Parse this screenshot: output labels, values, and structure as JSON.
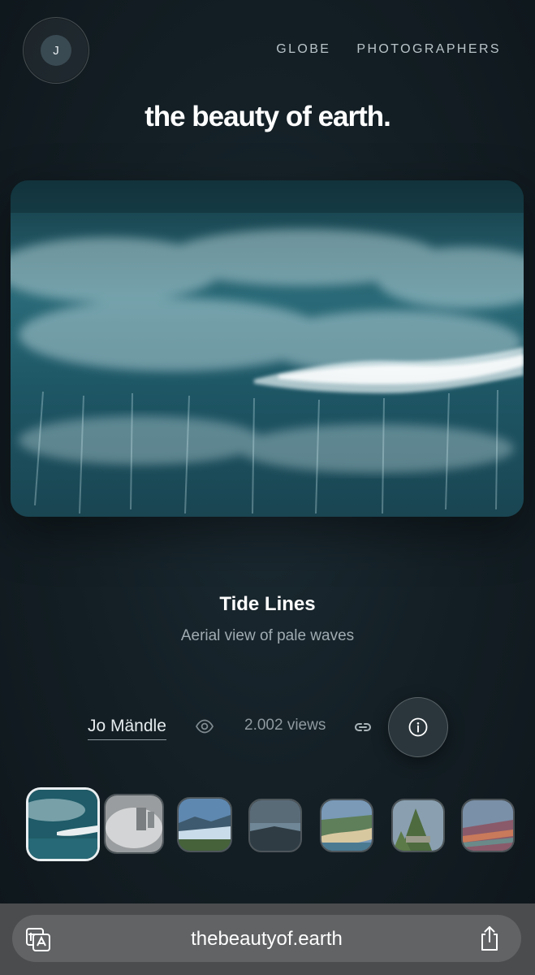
{
  "header": {
    "avatar_initial": "J",
    "nav": [
      {
        "label": "GLOBE"
      },
      {
        "label": "PHOTOGRAPHERS"
      }
    ]
  },
  "site_title": "the beauty of earth.",
  "photo": {
    "title": "Tide Lines",
    "description": "Aerial view of pale waves",
    "photographer": "Jo Mändle",
    "views": "2.002 views"
  },
  "icons": {
    "eye": "eye-icon",
    "link": "link-icon",
    "info": "info-icon",
    "translate": "translate-icon",
    "share": "share-icon"
  },
  "thumbnails": [
    {
      "subject": "ocean waves",
      "selected": true
    },
    {
      "subject": "misty waterfall",
      "selected": false
    },
    {
      "subject": "glacier",
      "selected": false
    },
    {
      "subject": "coastal lake",
      "selected": false
    },
    {
      "subject": "beach coastline",
      "selected": false
    },
    {
      "subject": "mountain ruins",
      "selected": false
    },
    {
      "subject": "rainbow mountains",
      "selected": false
    }
  ],
  "browser": {
    "url": "thebeautyof.earth"
  },
  "colors": {
    "background": "#142026",
    "accent": "#ffffff",
    "muted_text": "#9fabb1",
    "browser_bar": "#4a4c4e"
  }
}
